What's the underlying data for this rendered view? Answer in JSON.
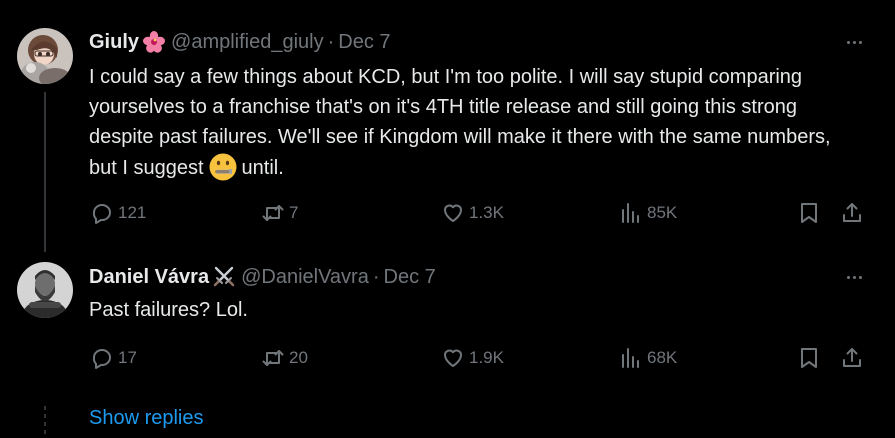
{
  "tweets": [
    {
      "author": {
        "name": "Giuly",
        "badge_icon": "hibiscus-flower-icon",
        "handle": "@amplified_giuly",
        "date": "Dec 7"
      },
      "text_before_emoji": "I could say a few things about KCD, but I'm too polite. I will say stupid comparing yourselves to a franchise that's on it's 4TH title release and still going this strong despite past failures. We'll see if Kingdom will make it there with the same numbers, but I suggest",
      "emoji_icon": "zipper-mouth-face-icon",
      "text_after_emoji": "until.",
      "stats": {
        "replies": "121",
        "reposts": "7",
        "likes": "1.3K",
        "views": "85K"
      }
    },
    {
      "author": {
        "name": "Daniel Vávra",
        "badge_icon": "crossed-swords-icon",
        "handle": "@DanielVavra",
        "date": "Dec 7"
      },
      "text": "Past failures? Lol.",
      "stats": {
        "replies": "17",
        "reposts": "20",
        "likes": "1.9K",
        "views": "68K"
      }
    }
  ],
  "show_replies_label": "Show replies",
  "separator": "·",
  "colors": {
    "background": "#000000",
    "text_primary": "#e7e9ea",
    "text_secondary": "#71767b",
    "link": "#1d9bf0",
    "thread_line": "#333639"
  }
}
